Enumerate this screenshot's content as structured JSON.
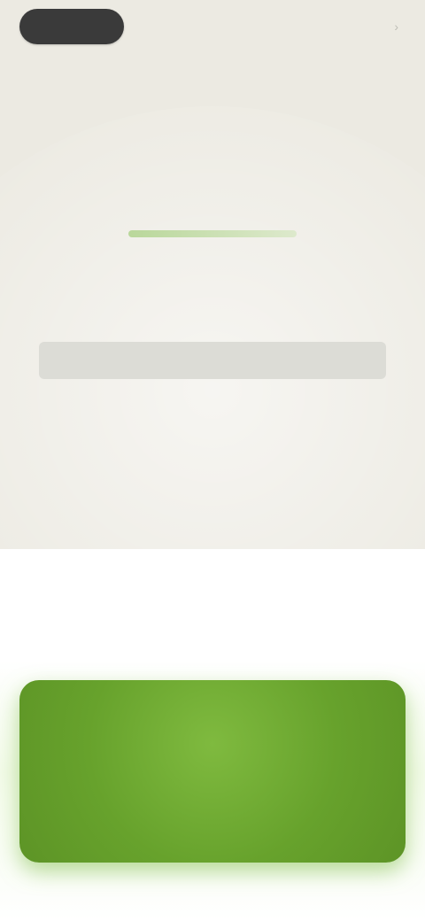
{
  "header": {
    "pill_label": "",
    "top_right_label": "",
    "top_right_icon": "chevron-right-icon"
  },
  "brand": {
    "logo_text": "",
    "tagline": ""
  },
  "content": {
    "description": "",
    "link_text": "",
    "primary_button_label": ""
  },
  "colors": {
    "hero_background": "#eceae2",
    "accent_green": "#6ea32f",
    "logo_green": "#6e9d3d",
    "pill": "#3a3a3a"
  }
}
